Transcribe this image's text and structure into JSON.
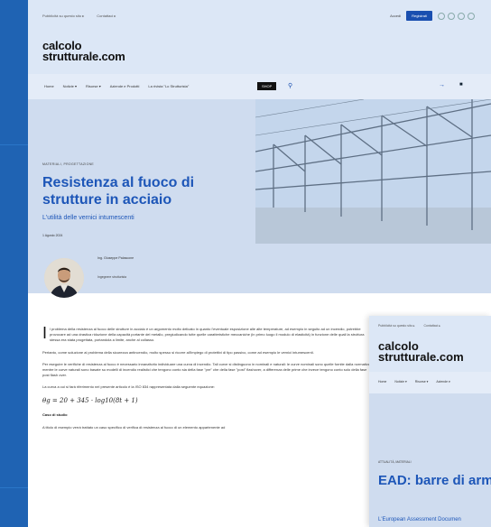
{
  "topbar": {
    "links": [
      "Pubblicità su questo sito ▸",
      "Contattaci ▸"
    ],
    "login_label": "Accedi",
    "register_label": "Registrati"
  },
  "brand": {
    "logo_line1": "calcolo",
    "logo_line2": "strutturale.com"
  },
  "nav": {
    "items": [
      "Home",
      "Notizie ▾",
      "Risorse ▾",
      "Aziende e Prodotti",
      "La rivista \"Lo Strutturista\""
    ],
    "shop_label": "SHOP"
  },
  "article": {
    "category": "MATERIALI, PROGETTAZIONE",
    "title": "Resistenza al fuoco di strutture in acciaio",
    "subtitle": "L'utilità delle vernici intumescenti",
    "date": "1 Agosto 2024",
    "author_name": "Ing. Giuseppe Palascone",
    "author_role": "Ingegnere strutturista",
    "dropcap": "I",
    "para1": "l problema della resistenza al fuoco delle strutture in acciaio è un argomento molto delicato in quanto l'eventuale esposizione alle alte temperature, ad esempio in seguito ad un incendio, potrebbe provocare ad una drastica riduzione della capacità portante del metallo, pregiudicando tutte quelle caratteristiche meccaniche (in primo luogo il modulo di elasticità) in funzione delle quali la struttura stessa era stata progettata, portandola a limite, anche al collasso.",
    "para2": "Pertanto, come soluzione al problema della sicurezza antincendio, molto spesso si ricorre all'impiego di protettivi di tipo passivo, come ad esempio le vernici intumescenti.",
    "para3": "Per eseguire le verifiche di resistenza al fuoco è necessario innanzitutto individuare una curva di incendio. Tali curve si distinguono in nominali e naturali: le curve nominali sono quelle fornite dalla normativa, mentre le curve naturali sono basate su modelli di incendio realistici che tengono conto sia della fase \"pre\" che della fase \"post\" flashover, a differenza delle prime che invece tengono conto solo della fase post flash over.",
    "para4": "La curva a cui si farà riferimento nel presente articolo è la ISO 834 rappresentata dalla seguente equazione:",
    "formula": "θg = 20 + 345 · log10(8t + 1)",
    "section_heading": "Caso di studio",
    "para5": "A titolo di esempio verrà trattato un caso specifico di verifica di resistenza al fuoco di un elemento appartenente ad"
  },
  "page2": {
    "links": [
      "Pubblicità su questo sito ▸",
      "Contattaci ▸"
    ],
    "logo_line1": "calcolo",
    "logo_line2": "strutturale.com",
    "nav_items": [
      "Home",
      "Notizie ▾",
      "Risorse ▾",
      "Aziende e"
    ],
    "category": "ATTUALITÀ, MATERIALI",
    "title": "EAD: barre di arm FRP",
    "subtitle": "L'European Assessment Documen"
  },
  "icons": [
    "facebook-icon",
    "youtube-icon",
    "linkedin-icon",
    "instagram-icon",
    "search-icon",
    "arrow-right-icon",
    "cart-icon"
  ],
  "colors": {
    "accent": "#1d56b8",
    "pale_blue": "#dce7f6",
    "frame": "#1f63b3"
  }
}
